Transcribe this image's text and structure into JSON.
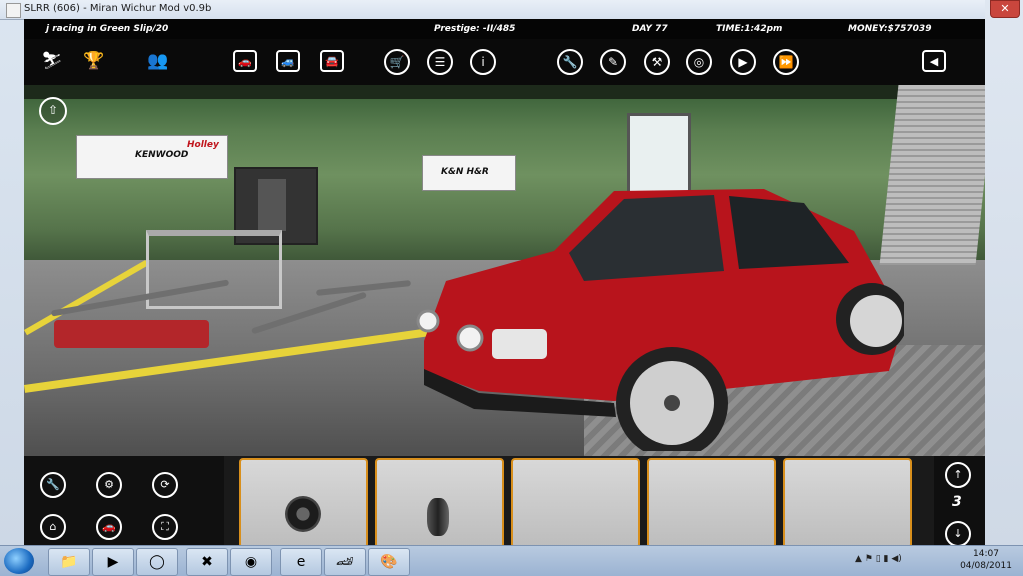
{
  "window": {
    "title": "SLRR (606) - Miran Wichur Mod v0.9b",
    "close_glyph": "✕"
  },
  "status": {
    "car": "j racing in Green Slip/20",
    "prestige": "Prestige: -II/485",
    "day": "DAY 77",
    "time": "TIME:1:42pm",
    "money": "MONEY:$757039"
  },
  "toolbar": {
    "icons": [
      "runner-icon",
      "trophy-icon",
      "people-icon",
      "car-dealer-icon",
      "garage-icon",
      "car-lot-icon",
      "shop-cart-icon",
      "list-icon",
      "info-icon",
      "wrench-icon",
      "screwdriver-icon",
      "tools-icon",
      "steering-wheel-icon",
      "play-icon",
      "fast-forward-icon",
      "exit-icon"
    ]
  },
  "scene": {
    "banners": [
      "KENWOOD",
      "Holley",
      "K&N H&R"
    ],
    "up_icon": "⇧"
  },
  "bottom": {
    "page_number": "3",
    "up_arrow": "↑",
    "down_arrow": "↓",
    "slots": [
      {
        "part": "rim-dark"
      },
      {
        "part": "rim-side"
      },
      {
        "part": ""
      },
      {
        "part": ""
      },
      {
        "part": ""
      }
    ]
  },
  "taskbar": {
    "time": "14:07",
    "date": "04/08/2011"
  },
  "colors": {
    "accent": "#d88f1c",
    "car": "#b8141c",
    "wall": "#5a7e50",
    "stripe": "#e7d33a"
  }
}
